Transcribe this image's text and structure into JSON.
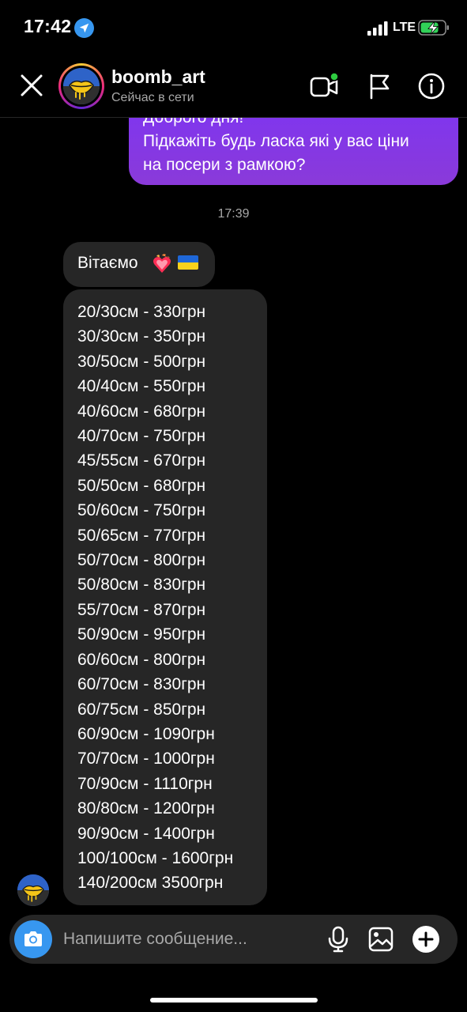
{
  "status_bar": {
    "time": "17:42",
    "network": "LTE",
    "icons": [
      "location-arrow-icon",
      "signal-bars-icon",
      "battery-charging-icon"
    ]
  },
  "header": {
    "username": "boomb_art",
    "presence": "Сейчас в сети",
    "icons": [
      "close-icon",
      "video-call-icon",
      "flag-icon",
      "info-icon"
    ]
  },
  "messages": {
    "sent_text": "Доброго дня!\nПідкажіть будь ласка які у вас ціни\nна посери з рамкою?",
    "timestamp": "17:39",
    "greeting": "Вітаємо",
    "greeting_emoji": [
      "heart-on-fire-icon",
      "ukraine-flag-icon"
    ],
    "price_list": [
      "20/30см - 330грн",
      "30/30см - 350грн",
      "30/50см - 500грн",
      "40/40см - 550грн",
      "40/60см - 680грн",
      "40/70см - 750грн",
      "45/55см - 670грн",
      "50/50см - 680грн",
      "50/60см - 750грн",
      "50/65см - 770грн",
      "50/70см - 800грн",
      "50/80см - 830грн",
      "55/70см - 870грн",
      "50/90см - 950грн",
      "60/60см - 800грн",
      "60/70см - 830грн",
      "60/75см - 850грн",
      "60/90см - 1090грн",
      "70/70см - 1000грн",
      "70/90см - 1110грн",
      "80/80см - 1200грн",
      "90/90см - 1400грн",
      "100/100см - 1600грн",
      "140/200см 3500грн"
    ]
  },
  "composer": {
    "placeholder": "Напишите сообщение...",
    "icons": [
      "camera-icon",
      "microphone-icon",
      "gallery-icon",
      "plus-icon"
    ]
  },
  "colors": {
    "background": "#000000",
    "sent_bubble": "#7d35f3",
    "received_bubble": "#262626",
    "camera_button": "#3797f0",
    "secondary_text": "#a8a8a8"
  }
}
